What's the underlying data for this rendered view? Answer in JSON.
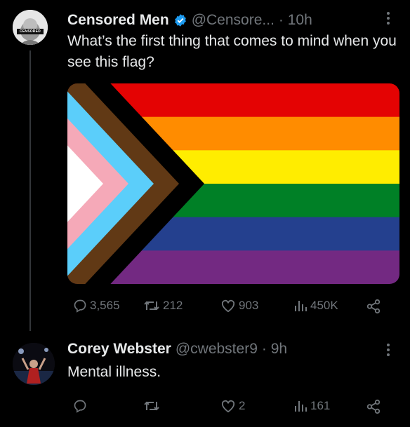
{
  "tweet1": {
    "author_name": "Censored Men",
    "handle": "@Censore...",
    "time": "· 10h",
    "text": "What’s the first thing that comes to mind when you see this flag?",
    "avatar_badge": "CENSORED",
    "stats": {
      "replies": "3,565",
      "reposts": "212",
      "likes": "903",
      "views": "450K"
    },
    "flag_colors": {
      "stripes": [
        "#E40303",
        "#FF8C00",
        "#FFED00",
        "#008026",
        "#24408E",
        "#732982"
      ],
      "chevrons": [
        "#FFFFFF",
        "#F5A9B8",
        "#5BCEFA",
        "#613915",
        "#000000"
      ]
    }
  },
  "tweet2": {
    "author_name": "Corey Webster",
    "handle": "@cwebster9",
    "time": "· 9h",
    "text": "Mental illness.",
    "stats": {
      "replies": "",
      "reposts": "",
      "likes": "2",
      "views": "161"
    }
  },
  "colors": {
    "verified": "#1D9BF0",
    "muted": "#71767b",
    "text": "#e7e9ea"
  }
}
